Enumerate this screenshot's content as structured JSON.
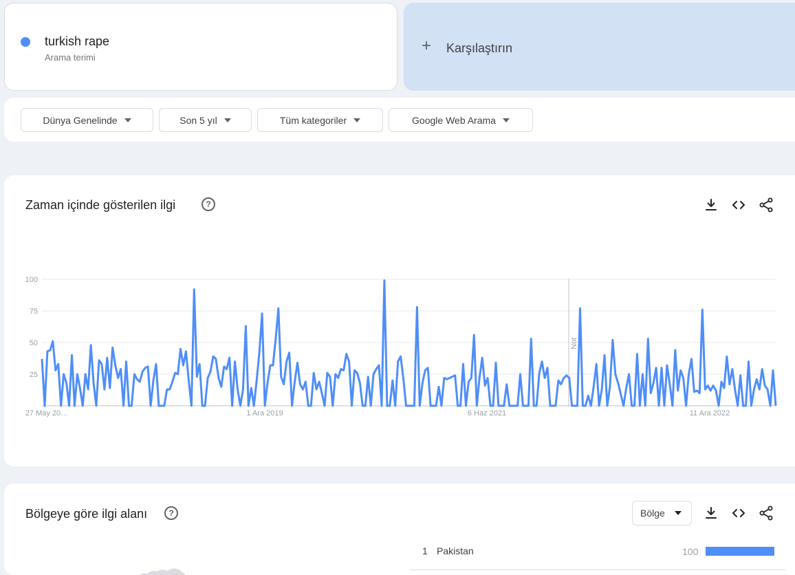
{
  "search_term": {
    "title": "turkish rape",
    "subtitle": "Arama terimi",
    "color": "#4f8ef7"
  },
  "compare": {
    "label": "Karşılaştırın"
  },
  "filters": [
    {
      "label": "Dünya Genelinde"
    },
    {
      "label": "Son 5 yıl"
    },
    {
      "label": "Tüm kategoriler"
    },
    {
      "label": "Google Web Arama"
    }
  ],
  "interest_over_time": {
    "title": "Zaman içinde gösterilen ilgi",
    "note_label": "Not",
    "icons": [
      "help-icon",
      "download-icon",
      "embed-icon",
      "share-icon"
    ]
  },
  "chart_data": {
    "type": "line",
    "ylim": [
      0,
      100
    ],
    "yticks": [
      25,
      50,
      75,
      100
    ],
    "xticks": [
      "27 May 20…",
      "1 Ara 2019",
      "6 Haz 2021",
      "11 Ara 2022"
    ],
    "series": [
      {
        "color": "#4f8ef7",
        "values": [
          37,
          0,
          43,
          44,
          51,
          28,
          33,
          0,
          25,
          18,
          0,
          40,
          0,
          25,
          14,
          0,
          25,
          13,
          48,
          18,
          0,
          36,
          33,
          13,
          38,
          14,
          46,
          32,
          22,
          29,
          0,
          35,
          0,
          0,
          25,
          21,
          19,
          27,
          30,
          31,
          0,
          20,
          33,
          0,
          0,
          0,
          13,
          13,
          19,
          26,
          25,
          45,
          32,
          43,
          20,
          0,
          92,
          23,
          33,
          0,
          0,
          22,
          27,
          39,
          37,
          22,
          15,
          31,
          29,
          38,
          0,
          35,
          13,
          0,
          13,
          63,
          0,
          14,
          0,
          20,
          42,
          73,
          0,
          18,
          32,
          32,
          53,
          77,
          23,
          17,
          35,
          42,
          0,
          19,
          34,
          17,
          13,
          19,
          0,
          0,
          26,
          13,
          19,
          10,
          0,
          26,
          23,
          0,
          25,
          22,
          29,
          28,
          41,
          35,
          0,
          28,
          26,
          18,
          0,
          0,
          23,
          0,
          25,
          29,
          32,
          0,
          99,
          0,
          0,
          20,
          0,
          35,
          39,
          21,
          0,
          0,
          0,
          0,
          78,
          0,
          18,
          28,
          30,
          0,
          0,
          0,
          15,
          0,
          22,
          21,
          22,
          23,
          24,
          0,
          0,
          33,
          0,
          19,
          22,
          56,
          0,
          22,
          38,
          16,
          22,
          0,
          0,
          34,
          0,
          0,
          0,
          17,
          0,
          0,
          0,
          0,
          25,
          0,
          0,
          0,
          53,
          0,
          0,
          26,
          35,
          22,
          30,
          0,
          0,
          0,
          20,
          17,
          22,
          24,
          22,
          0,
          0,
          0,
          77,
          0,
          0,
          8,
          0,
          15,
          33,
          0,
          13,
          40,
          0,
          15,
          52,
          25,
          18,
          9,
          0,
          14,
          25,
          0,
          0,
          41,
          0,
          25,
          0,
          53,
          10,
          18,
          30,
          0,
          30,
          0,
          32,
          17,
          0,
          44,
          12,
          28,
          22,
          0,
          25,
          37,
          11,
          12,
          10,
          76,
          13,
          16,
          12,
          16,
          12,
          0,
          19,
          14,
          39,
          17,
          29,
          13,
          0,
          24,
          0,
          0,
          35,
          0,
          13,
          21,
          13,
          29,
          16,
          13,
          0,
          28,
          0
        ]
      }
    ]
  },
  "interest_by_region": {
    "title": "Bölgeye göre ilgi alanı",
    "select_label": "Bölge",
    "rows": [
      {
        "rank": "1",
        "name": "Pakistan",
        "value": "100",
        "fraction": 1.0
      }
    ]
  }
}
